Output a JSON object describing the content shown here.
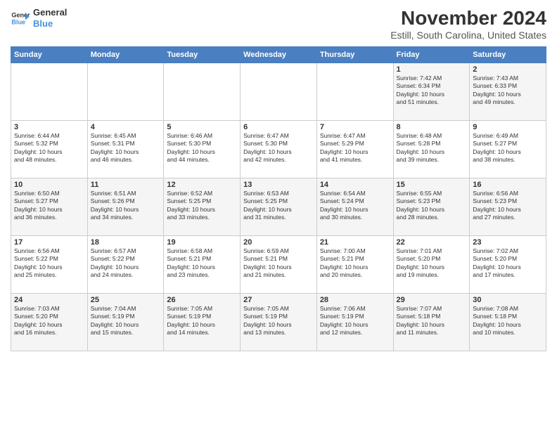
{
  "logo": {
    "line1": "General",
    "line2": "Blue"
  },
  "title": "November 2024",
  "subtitle": "Estill, South Carolina, United States",
  "days_of_week": [
    "Sunday",
    "Monday",
    "Tuesday",
    "Wednesday",
    "Thursday",
    "Friday",
    "Saturday"
  ],
  "weeks": [
    [
      {
        "day": "",
        "info": ""
      },
      {
        "day": "",
        "info": ""
      },
      {
        "day": "",
        "info": ""
      },
      {
        "day": "",
        "info": ""
      },
      {
        "day": "",
        "info": ""
      },
      {
        "day": "1",
        "info": "Sunrise: 7:42 AM\nSunset: 6:34 PM\nDaylight: 10 hours\nand 51 minutes."
      },
      {
        "day": "2",
        "info": "Sunrise: 7:43 AM\nSunset: 6:33 PM\nDaylight: 10 hours\nand 49 minutes."
      }
    ],
    [
      {
        "day": "3",
        "info": "Sunrise: 6:44 AM\nSunset: 5:32 PM\nDaylight: 10 hours\nand 48 minutes."
      },
      {
        "day": "4",
        "info": "Sunrise: 6:45 AM\nSunset: 5:31 PM\nDaylight: 10 hours\nand 46 minutes."
      },
      {
        "day": "5",
        "info": "Sunrise: 6:46 AM\nSunset: 5:30 PM\nDaylight: 10 hours\nand 44 minutes."
      },
      {
        "day": "6",
        "info": "Sunrise: 6:47 AM\nSunset: 5:30 PM\nDaylight: 10 hours\nand 42 minutes."
      },
      {
        "day": "7",
        "info": "Sunrise: 6:47 AM\nSunset: 5:29 PM\nDaylight: 10 hours\nand 41 minutes."
      },
      {
        "day": "8",
        "info": "Sunrise: 6:48 AM\nSunset: 5:28 PM\nDaylight: 10 hours\nand 39 minutes."
      },
      {
        "day": "9",
        "info": "Sunrise: 6:49 AM\nSunset: 5:27 PM\nDaylight: 10 hours\nand 38 minutes."
      }
    ],
    [
      {
        "day": "10",
        "info": "Sunrise: 6:50 AM\nSunset: 5:27 PM\nDaylight: 10 hours\nand 36 minutes."
      },
      {
        "day": "11",
        "info": "Sunrise: 6:51 AM\nSunset: 5:26 PM\nDaylight: 10 hours\nand 34 minutes."
      },
      {
        "day": "12",
        "info": "Sunrise: 6:52 AM\nSunset: 5:25 PM\nDaylight: 10 hours\nand 33 minutes."
      },
      {
        "day": "13",
        "info": "Sunrise: 6:53 AM\nSunset: 5:25 PM\nDaylight: 10 hours\nand 31 minutes."
      },
      {
        "day": "14",
        "info": "Sunrise: 6:54 AM\nSunset: 5:24 PM\nDaylight: 10 hours\nand 30 minutes."
      },
      {
        "day": "15",
        "info": "Sunrise: 6:55 AM\nSunset: 5:23 PM\nDaylight: 10 hours\nand 28 minutes."
      },
      {
        "day": "16",
        "info": "Sunrise: 6:56 AM\nSunset: 5:23 PM\nDaylight: 10 hours\nand 27 minutes."
      }
    ],
    [
      {
        "day": "17",
        "info": "Sunrise: 6:56 AM\nSunset: 5:22 PM\nDaylight: 10 hours\nand 25 minutes."
      },
      {
        "day": "18",
        "info": "Sunrise: 6:57 AM\nSunset: 5:22 PM\nDaylight: 10 hours\nand 24 minutes."
      },
      {
        "day": "19",
        "info": "Sunrise: 6:58 AM\nSunset: 5:21 PM\nDaylight: 10 hours\nand 23 minutes."
      },
      {
        "day": "20",
        "info": "Sunrise: 6:59 AM\nSunset: 5:21 PM\nDaylight: 10 hours\nand 21 minutes."
      },
      {
        "day": "21",
        "info": "Sunrise: 7:00 AM\nSunset: 5:21 PM\nDaylight: 10 hours\nand 20 minutes."
      },
      {
        "day": "22",
        "info": "Sunrise: 7:01 AM\nSunset: 5:20 PM\nDaylight: 10 hours\nand 19 minutes."
      },
      {
        "day": "23",
        "info": "Sunrise: 7:02 AM\nSunset: 5:20 PM\nDaylight: 10 hours\nand 17 minutes."
      }
    ],
    [
      {
        "day": "24",
        "info": "Sunrise: 7:03 AM\nSunset: 5:20 PM\nDaylight: 10 hours\nand 16 minutes."
      },
      {
        "day": "25",
        "info": "Sunrise: 7:04 AM\nSunset: 5:19 PM\nDaylight: 10 hours\nand 15 minutes."
      },
      {
        "day": "26",
        "info": "Sunrise: 7:05 AM\nSunset: 5:19 PM\nDaylight: 10 hours\nand 14 minutes."
      },
      {
        "day": "27",
        "info": "Sunrise: 7:05 AM\nSunset: 5:19 PM\nDaylight: 10 hours\nand 13 minutes."
      },
      {
        "day": "28",
        "info": "Sunrise: 7:06 AM\nSunset: 5:19 PM\nDaylight: 10 hours\nand 12 minutes."
      },
      {
        "day": "29",
        "info": "Sunrise: 7:07 AM\nSunset: 5:18 PM\nDaylight: 10 hours\nand 11 minutes."
      },
      {
        "day": "30",
        "info": "Sunrise: 7:08 AM\nSunset: 5:18 PM\nDaylight: 10 hours\nand 10 minutes."
      }
    ]
  ]
}
